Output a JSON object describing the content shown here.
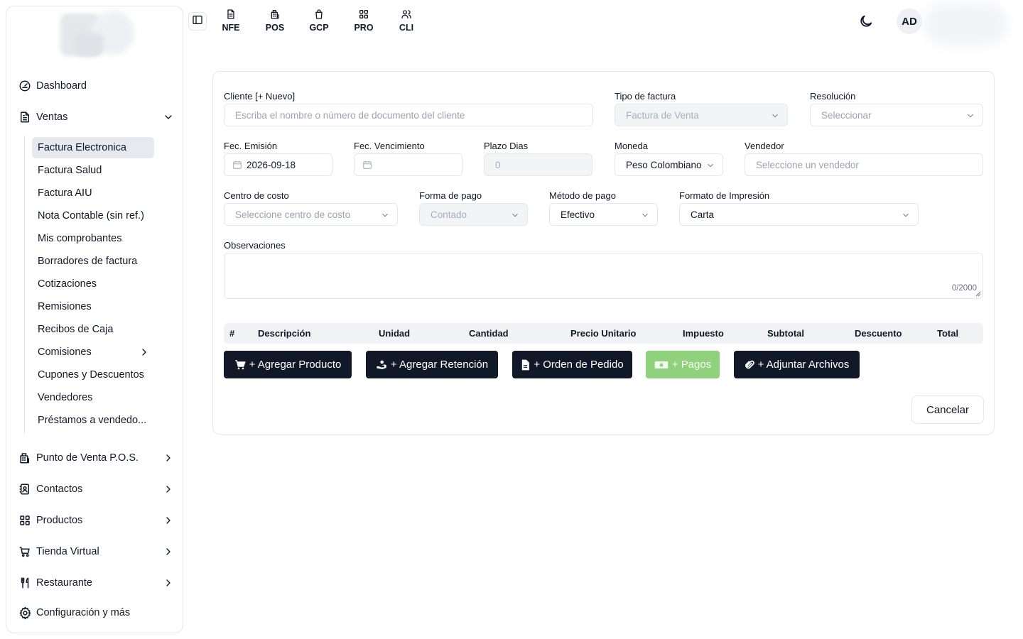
{
  "sidebar": {
    "items": [
      {
        "label": "Dashboard",
        "icon": "gauge-icon"
      },
      {
        "label": "Ventas",
        "icon": "document-icon"
      },
      {
        "label": "Punto de Venta P.O.S.",
        "icon": "pos-icon"
      },
      {
        "label": "Contactos",
        "icon": "contacts-icon"
      },
      {
        "label": "Productos",
        "icon": "grid-icon"
      },
      {
        "label": "Tienda Virtual",
        "icon": "cart-icon"
      },
      {
        "label": "Restaurante",
        "icon": "utensils-icon"
      },
      {
        "label": "Configuración y más",
        "icon": "gear-icon"
      }
    ],
    "ventas_sub": [
      "Factura Electronica",
      "Factura Salud",
      "Factura AIU",
      "Nota Contable (sin ref.)",
      "Mis comprobantes",
      "Borradores de factura",
      "Cotizaciones",
      "Remisiones",
      "Recibos de Caja",
      "Comisiones",
      "Cupones y Descuentos",
      "Vendedores",
      "Préstamos a vendedo..."
    ]
  },
  "topbar": {
    "nav": [
      {
        "label": "NFE",
        "icon": "file-icon"
      },
      {
        "label": "POS",
        "icon": "pos-icon"
      },
      {
        "label": "GCP",
        "icon": "bag-icon"
      },
      {
        "label": "PRO",
        "icon": "grid-icon"
      },
      {
        "label": "CLI",
        "icon": "users-icon"
      }
    ],
    "avatar": "AD"
  },
  "form": {
    "cliente": {
      "label": "Cliente [+ Nuevo]",
      "placeholder": "Escriba el nombre o número de documento del cliente"
    },
    "tipo_factura": {
      "label": "Tipo de factura",
      "value": "Factura de Venta"
    },
    "resolucion": {
      "label": "Resolución",
      "placeholder": "Seleccionar"
    },
    "fec_emision": {
      "label": "Fec. Emisión",
      "value": "2026-09-18"
    },
    "fec_vencimiento": {
      "label": "Fec. Vencimiento",
      "value": ""
    },
    "plazo_dias": {
      "label": "Plazo Dias",
      "value": "0"
    },
    "moneda": {
      "label": "Moneda",
      "value": "Peso Colombiano"
    },
    "vendedor": {
      "label": "Vendedor",
      "placeholder": "Seleccione un vendedor"
    },
    "centro_costo": {
      "label": "Centro de costo",
      "placeholder": "Seleccione centro de costo"
    },
    "forma_pago": {
      "label": "Forma de pago",
      "value": "Contado"
    },
    "metodo_pago": {
      "label": "Método de pago",
      "value": "Efectivo"
    },
    "formato_impresion": {
      "label": "Formato de Impresión",
      "value": "Carta"
    },
    "observaciones": {
      "label": "Observaciones",
      "counter": "0/2000"
    }
  },
  "table": {
    "columns": [
      "#",
      "Descripción",
      "Unidad",
      "Cantidad",
      "Precio Unitario",
      "Impuesto",
      "Subtotal",
      "Descuento",
      "Total"
    ]
  },
  "actions": {
    "agregar_producto": "+ Agregar Producto",
    "agregar_retencion": "+ Agregar Retención",
    "orden_pedido": "+ Orden de Pedido",
    "pagos": "+ Pagos",
    "adjuntar": "+ Adjuntar Archivos",
    "cancelar": "Cancelar"
  },
  "colors": {
    "primary_button": "#111827",
    "pagos_button": "#8fd17c",
    "active_item": "#e7e9ee"
  }
}
